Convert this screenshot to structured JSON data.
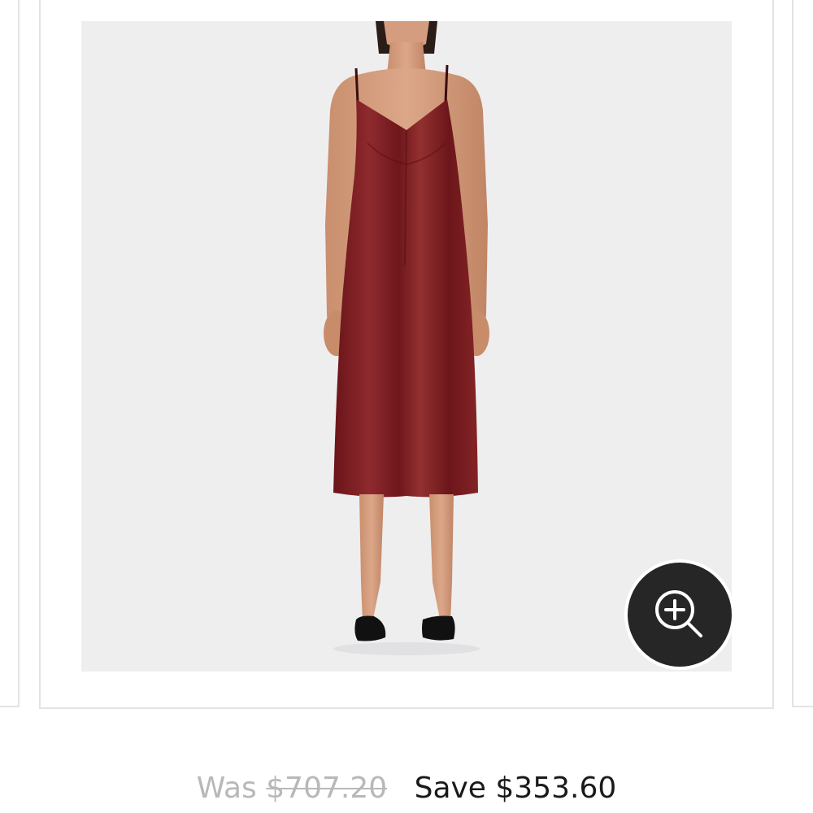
{
  "product": {
    "image_alt": "Red satin slip midi dress",
    "zoom_icon": "zoom-in-icon"
  },
  "pricing": {
    "was_label": "Was",
    "was_price": "$707.20",
    "save_text": "Save $353.60"
  },
  "colors": {
    "dress": "#7a1c21",
    "image_background": "#eeeeef",
    "zoom_button": "#262626",
    "muted_text": "#b8b8b8"
  }
}
